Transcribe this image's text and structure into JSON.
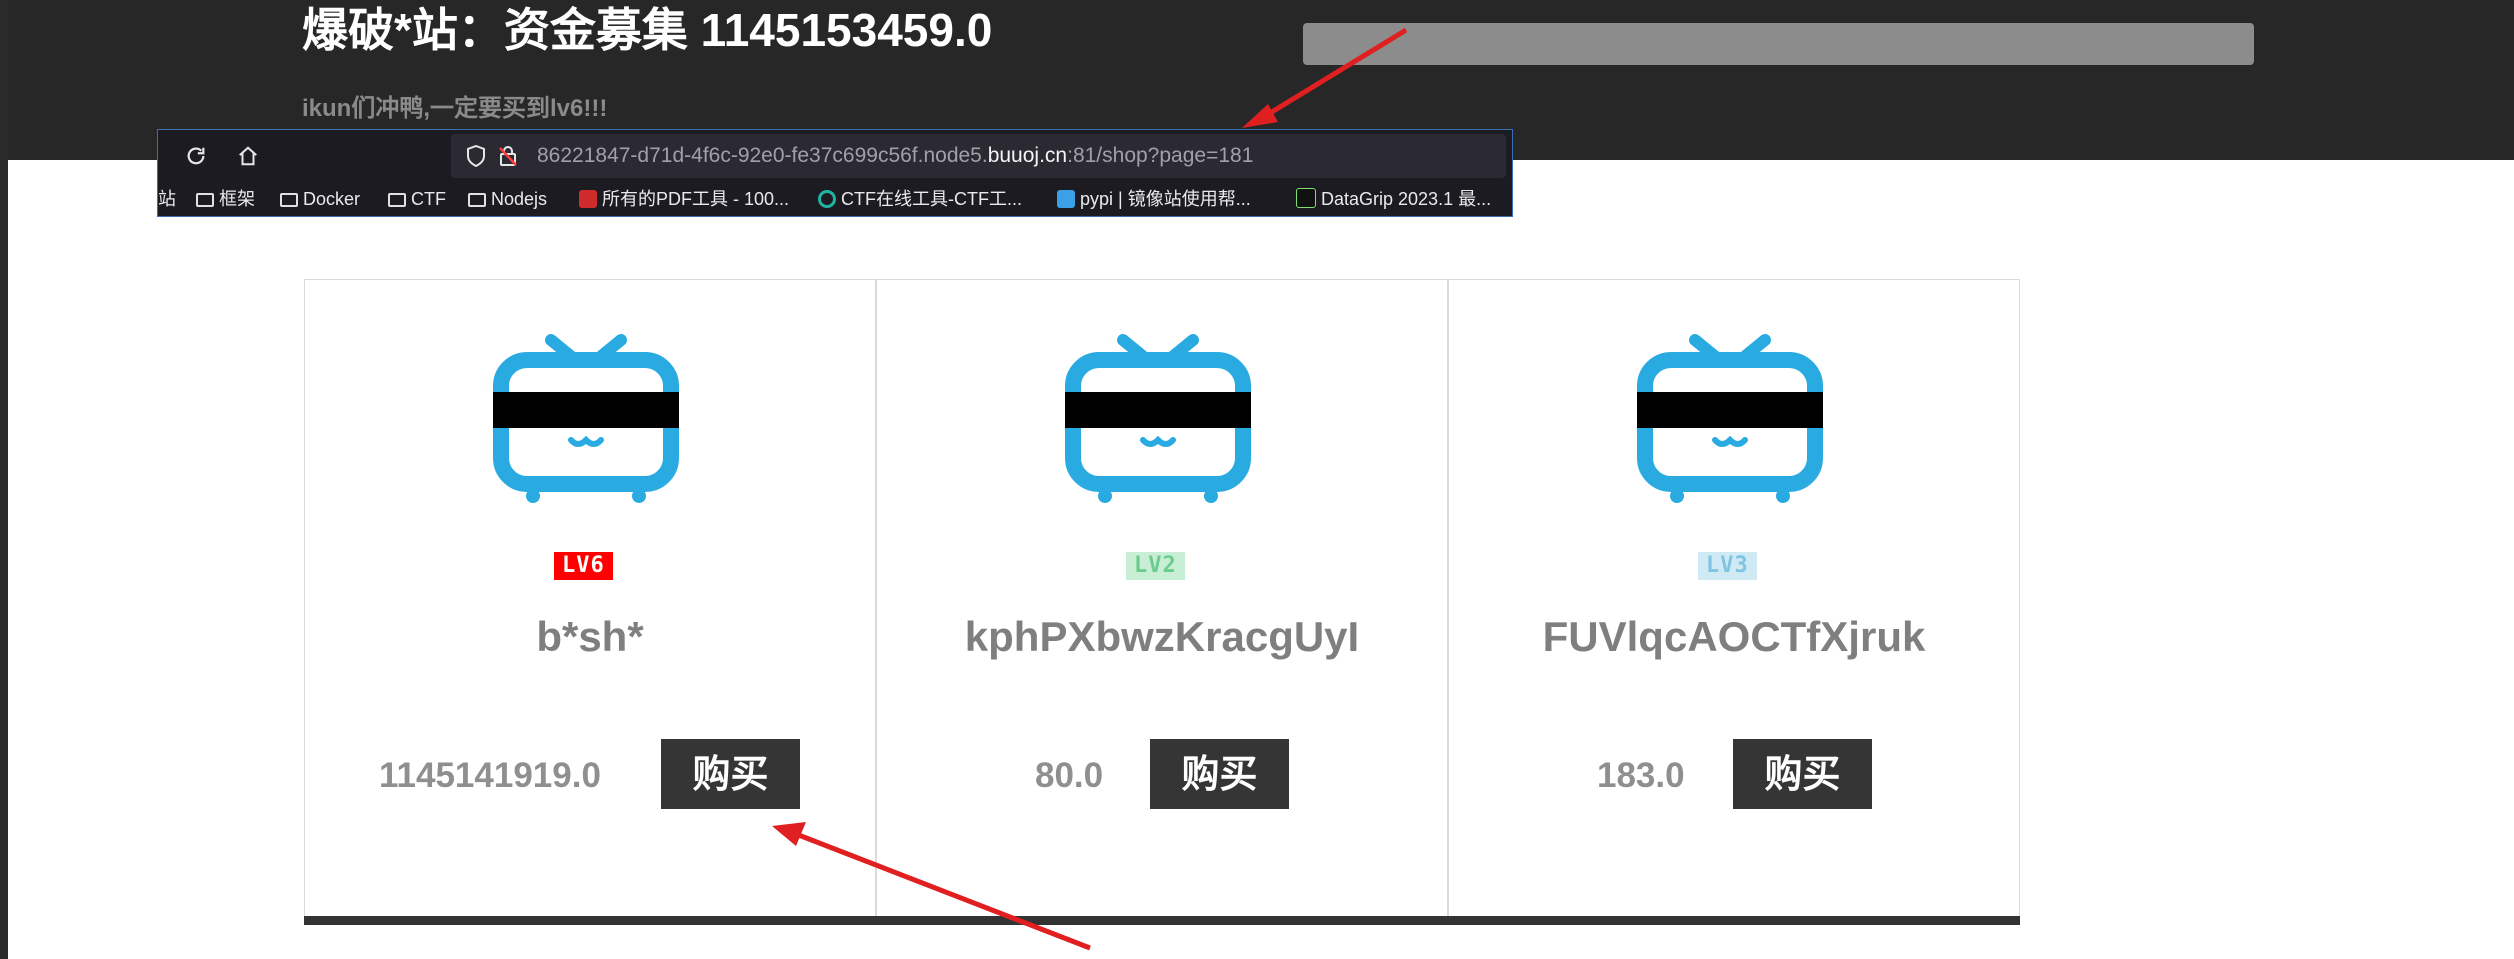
{
  "header": {
    "title": "爆破*站：资金募集 1145153459.0",
    "subtitle": "ikun们冲鸭,一定要买到lv6!!!"
  },
  "browser": {
    "url_prefix": "86221847-d71d-4f6c-92e0-fe37c699c56f.node5.",
    "url_domain": "buuoj.cn",
    "url_suffix": ":81/shop?page=181",
    "bookmarks": [
      {
        "label": "站",
        "icon": "none"
      },
      {
        "label": "框架",
        "icon": "folder-icon"
      },
      {
        "label": "Docker",
        "icon": "folder-icon"
      },
      {
        "label": "CTF",
        "icon": "folder-icon"
      },
      {
        "label": "Nodejs",
        "icon": "folder-icon"
      },
      {
        "label": "所有的PDF工具 - 100...",
        "icon": "pdf-favicon"
      },
      {
        "label": "CTF在线工具-CTF工...",
        "icon": "ctf-favicon"
      },
      {
        "label": "pypi | 镜像站使用帮...",
        "icon": "pypi-favicon"
      },
      {
        "label": "DataGrip 2023.1 最...",
        "icon": "datagrip-favicon"
      }
    ]
  },
  "cards": [
    {
      "level": "LV6",
      "level_color": "#ff0000",
      "name": "b*sh*",
      "price": "1145141919.0",
      "buy_label": "购买"
    },
    {
      "level": "LV2",
      "level_color": "#8fd8a8",
      "name": "kphPXbwzKracgUyI",
      "price": "80.0",
      "buy_label": "购买"
    },
    {
      "level": "LV3",
      "level_color": "#8ccde8",
      "name": "FUVlqcAOCTfXjruk",
      "price": "183.0",
      "buy_label": "购买"
    }
  ],
  "colors": {
    "header_bg": "#272727",
    "tv_blue": "#29abe2",
    "button_bg": "#353535",
    "annotation_red": "#e02020"
  }
}
